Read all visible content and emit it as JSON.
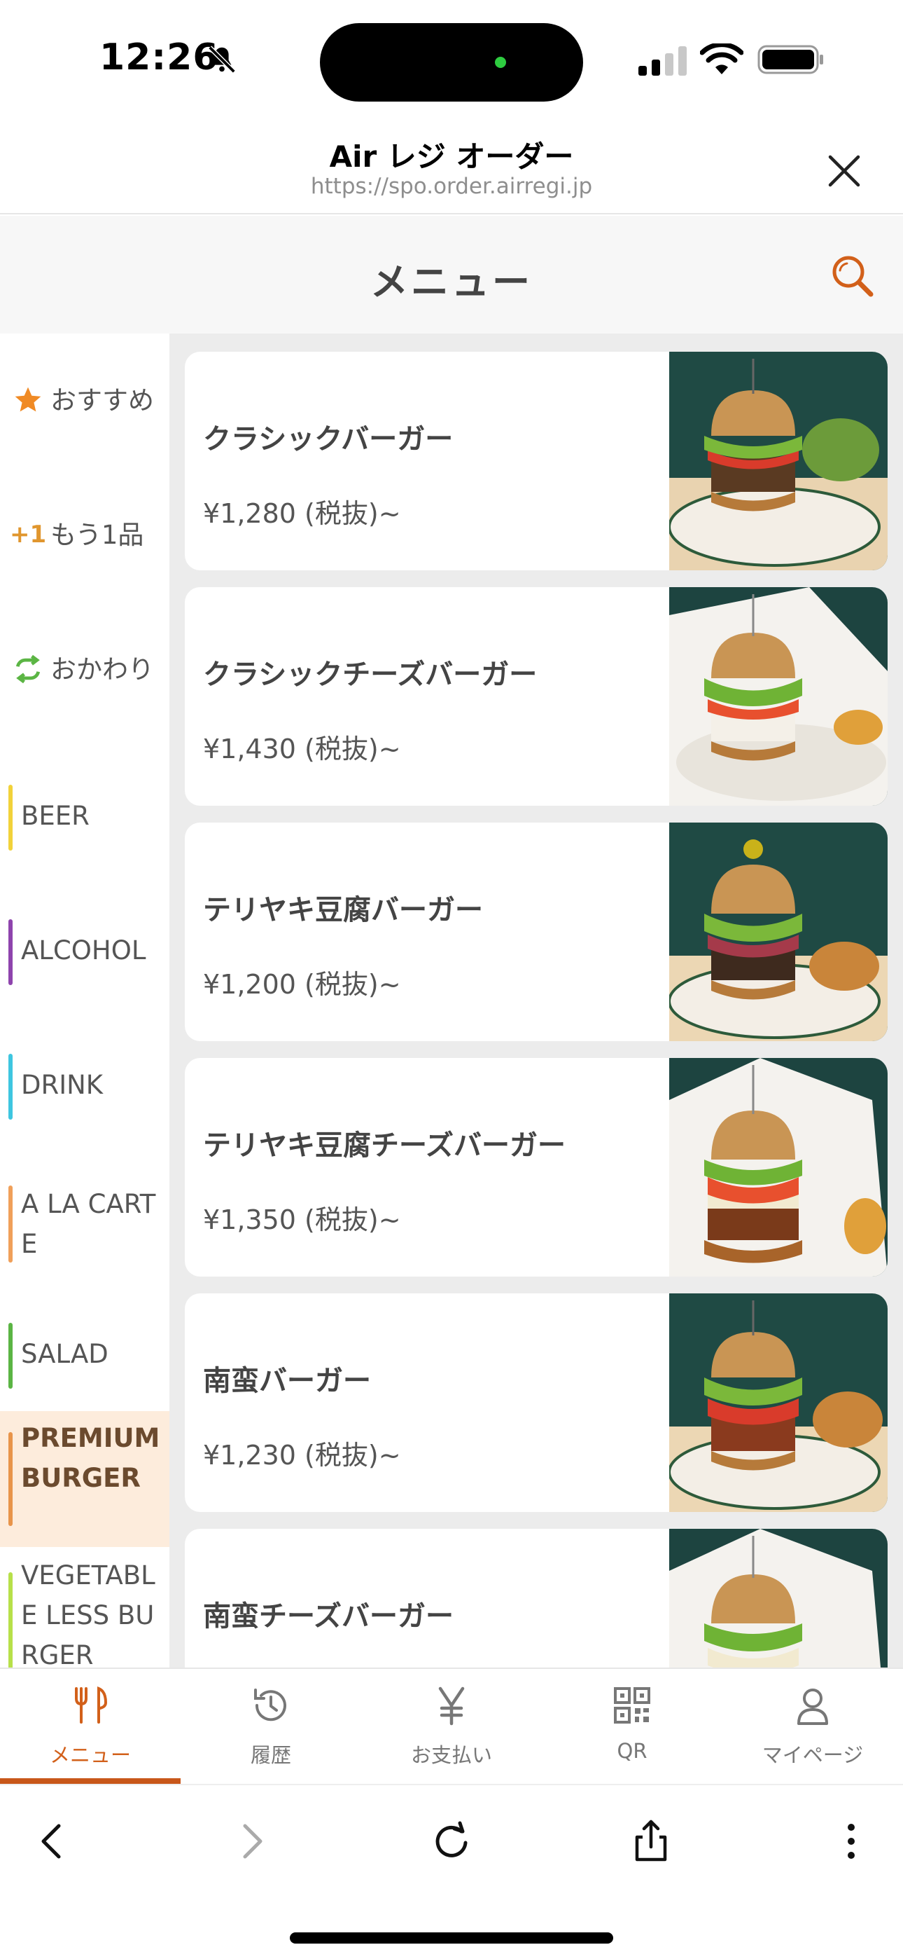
{
  "status_bar": {
    "time": "12:26"
  },
  "browser": {
    "title": "Air レジ オーダー",
    "url": "https://spo.order.airregi.jp"
  },
  "app": {
    "title": "メニュー"
  },
  "sidebar": {
    "special": [
      {
        "icon": "star-icon",
        "label": "おすすめ",
        "color": "#f08a24"
      },
      {
        "icon": "plus-one-icon",
        "label": "もう1品",
        "color": "#e0962e"
      },
      {
        "icon": "refill-icon",
        "label": "おかわり",
        "color": "#5bb544"
      }
    ],
    "categories": [
      {
        "label": "BEER",
        "color": "#f2d23a"
      },
      {
        "label": "ALCOHOL",
        "color": "#8e44ad"
      },
      {
        "label": "DRINK",
        "color": "#3ec6e0"
      },
      {
        "label": "A LA CARTE",
        "color": "#f0a05a"
      },
      {
        "label": "SALAD",
        "color": "#5bb544"
      },
      {
        "label": "PREMIUM BURGER",
        "color": "#e8944a",
        "active": true
      },
      {
        "label": "VEGETABLE LESS BURGER",
        "color": "#b7e04a"
      }
    ]
  },
  "menu_items": [
    {
      "name": "クラシックバーガー",
      "price": "¥1,280 (税抜)~"
    },
    {
      "name": "クラシックチーズバーガー",
      "price": "¥1,430 (税抜)~"
    },
    {
      "name": "テリヤキ豆腐バーガー",
      "price": "¥1,200 (税抜)~"
    },
    {
      "name": "テリヤキ豆腐チーズバーガー",
      "price": "¥1,350 (税抜)~"
    },
    {
      "name": "南蛮バーガー",
      "price": "¥1,230 (税抜)~"
    },
    {
      "name": "南蛮チーズバーガー",
      "price": ""
    }
  ],
  "tabs": [
    {
      "label": "メニュー",
      "icon": "fork-knife-icon",
      "active": true
    },
    {
      "label": "履歴",
      "icon": "history-icon"
    },
    {
      "label": "お支払い",
      "icon": "yen-icon"
    },
    {
      "label": "QR",
      "icon": "qr-code-icon"
    },
    {
      "label": "マイページ",
      "icon": "person-icon"
    }
  ],
  "colors": {
    "accent": "#d2601a",
    "active_bg": "#fdecdc"
  }
}
